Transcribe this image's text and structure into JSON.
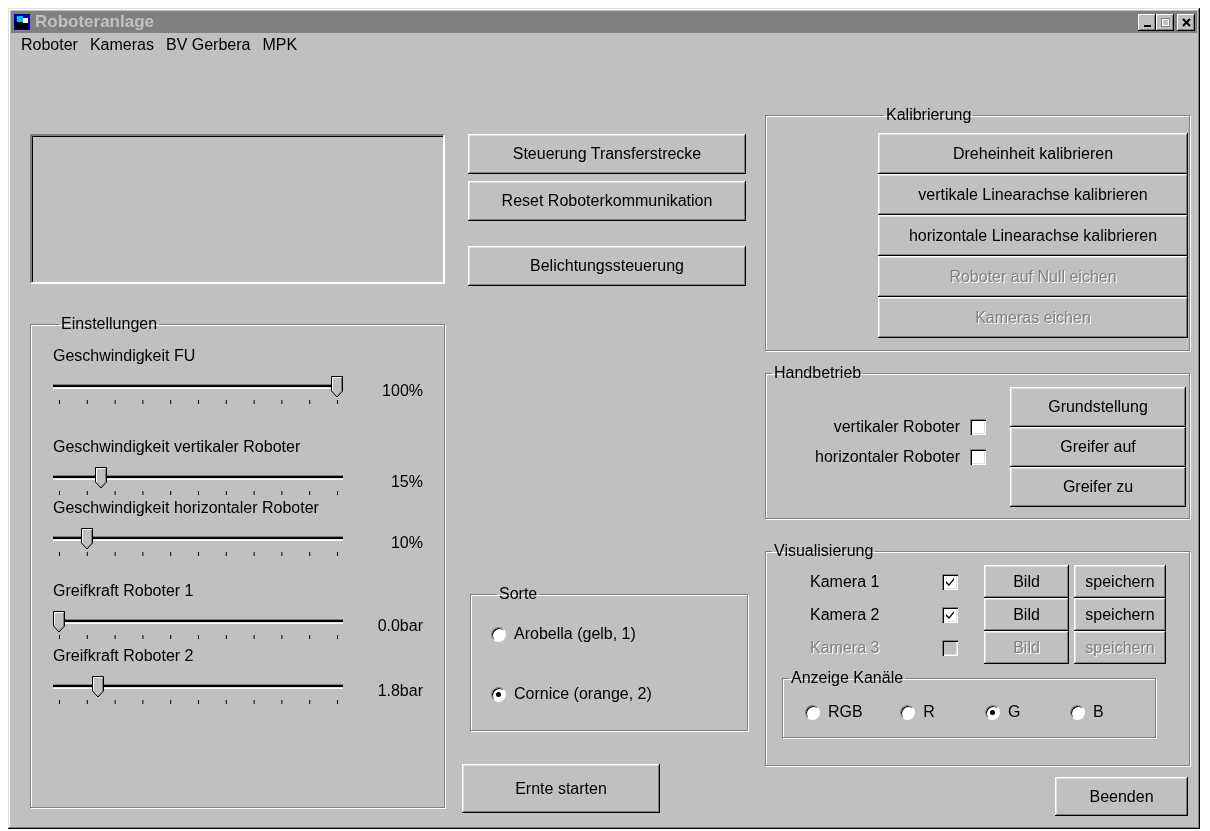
{
  "window": {
    "title": "Roboteranlage"
  },
  "menu": [
    {
      "label": "Roboter"
    },
    {
      "label": "Kameras"
    },
    {
      "label": "BV Gerbera"
    },
    {
      "label": "MPK"
    }
  ],
  "actions": [
    {
      "label": "Steuerung Transferstrecke"
    },
    {
      "label": "Reset Roboterkommunikation"
    },
    {
      "label": "Belichtungssteuerung"
    }
  ],
  "settings": {
    "title": "Einstellungen",
    "sliders": [
      {
        "label": "Geschwindigkeit FU",
        "level": 1,
        "reading": "100%"
      },
      {
        "label": "Geschwindigkeit vertikaler Roboter",
        "level": 0.15,
        "reading": "15%"
      },
      {
        "label": "Geschwindigkeit horizontaler Roboter",
        "level": 0.1,
        "reading": "10%"
      },
      {
        "label": "Greifkraft Roboter 1",
        "level": 0,
        "reading": "0.0bar"
      },
      {
        "label": "Greifkraft Roboter 2",
        "level": 0.14,
        "reading": "1.8bar"
      }
    ]
  },
  "sort": {
    "title": "Sorte",
    "options": [
      {
        "label": "Arobella (gelb, 1)",
        "selected": false
      },
      {
        "label": "Cornice (orange, 2)",
        "selected": true
      }
    ]
  },
  "harvest_button": "Ernte starten",
  "calibration": {
    "title": "Kalibrierung",
    "buttons": [
      {
        "label": "Dreheinheit kalibrieren",
        "disabled": false
      },
      {
        "label": "vertikale Linearachse kalibrieren",
        "disabled": false
      },
      {
        "label": "horizontale Linearachse kalibrieren",
        "disabled": false
      },
      {
        "label": "Roboter auf Null eichen",
        "disabled": true
      },
      {
        "label": "Kameras eichen",
        "disabled": true
      }
    ]
  },
  "manual": {
    "title": "Handbetrieb",
    "toggles": [
      {
        "label": "vertikaler Roboter",
        "checked": false
      },
      {
        "label": "horizontaler Roboter",
        "checked": false
      }
    ],
    "buttons": [
      {
        "label": "Grundstellung"
      },
      {
        "label": "Greifer auf"
      },
      {
        "label": "Greifer zu"
      }
    ]
  },
  "visualization": {
    "title": "Visualisierung",
    "cameras": [
      {
        "label": "Kamera 1",
        "checked": true,
        "disabled": false,
        "image_button": "Bild",
        "save_button": "speichern"
      },
      {
        "label": "Kamera 2",
        "checked": true,
        "disabled": false,
        "image_button": "Bild",
        "save_button": "speichern"
      },
      {
        "label": "Kamera 3",
        "checked": false,
        "disabled": true,
        "image_button": "Bild",
        "save_button": "speichern"
      }
    ],
    "channels": {
      "title": "Anzeige Kanäle",
      "options": [
        {
          "label": "RGB",
          "selected": false
        },
        {
          "label": "R",
          "selected": false
        },
        {
          "label": "G",
          "selected": true
        },
        {
          "label": "B",
          "selected": false
        }
      ]
    }
  },
  "exit_button": "Beenden"
}
